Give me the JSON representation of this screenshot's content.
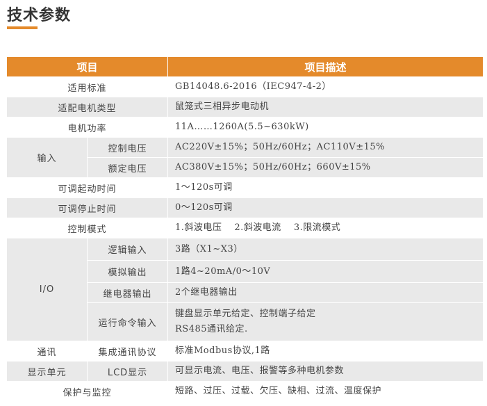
{
  "page": {
    "title": "技术参数",
    "accent_color": "#e48a2b",
    "stripe_color": "#e9e9e9"
  },
  "table": {
    "headers": {
      "item": "项目",
      "description": "项目描述"
    },
    "rows": {
      "standard": {
        "label": "适用标准",
        "value": "GB14048.6-2016（IEC947-4-2）"
      },
      "motor_type": {
        "label": "适配电机类型",
        "value": "鼠笼式三相异步电动机"
      },
      "motor_power": {
        "label": "电机功率",
        "value": "11A……1260A(5.5~630kW)"
      },
      "input": {
        "label": "输入",
        "control_voltage": {
          "label": "控制电压",
          "value": "AC220V±15%；50Hz/60Hz；AC110V±15%"
        },
        "rated_voltage": {
          "label": "额定电压",
          "value": "AC380V±15%；50Hz/60Hz；660V±15%"
        }
      },
      "start_time": {
        "label": "可调起动时间",
        "value": "1～120s可调"
      },
      "stop_time": {
        "label": "可调停止时间",
        "value": "0～120s可调"
      },
      "control_mode": {
        "label": "控制模式",
        "options": [
          "1.斜波电压",
          "2.斜波电流",
          "3.限流模式"
        ]
      },
      "io": {
        "label": "I/O",
        "logic_input": {
          "label": "逻辑输入",
          "value": "3路（X1~X3）"
        },
        "analog_output": {
          "label": "模拟输出",
          "value": "1路4~20mA/0～10V"
        },
        "relay_output": {
          "label": "继电器输出",
          "value": "2个继电器输出"
        },
        "run_command": {
          "label": "运行命令输入",
          "value_line1": "键盘显示单元给定、控制端子给定",
          "value_line2": "RS485通讯给定."
        }
      },
      "comm": {
        "label": "通讯",
        "sub_label": "集成通讯协议",
        "value": "标准Modbus协议,1路"
      },
      "display": {
        "label": "显示单元",
        "sub_label": "LCD显示",
        "value": "可显示电流、电压、报警等多种电机参数"
      },
      "protection": {
        "label": "保护与监控",
        "value": "短路、过压、过载、欠压、缺相、过流、温度保护"
      }
    }
  }
}
